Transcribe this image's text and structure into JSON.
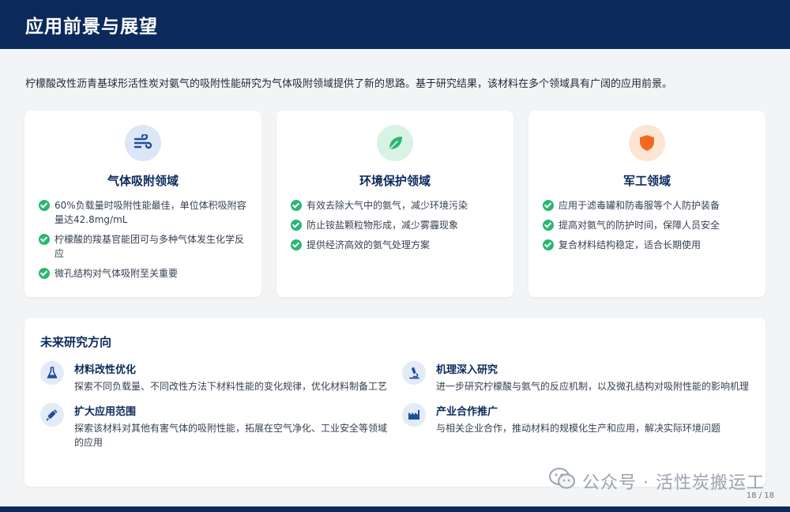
{
  "header": {
    "title": "应用前景与展望"
  },
  "intro": "柠檬酸改性沥青基球形活性炭对氨气的吸附性能研究为气体吸附领域提供了新的思路。基于研究结果，该材料在多个领域具有广阔的应用前景。",
  "cards": [
    {
      "title": "气体吸附领域",
      "icon": "wind-icon",
      "bullets": [
        "60%负载量时吸附性能最佳，单位体积吸附容量达42.8mg/mL",
        "柠檬酸的羧基官能团可与多种气体发生化学反应",
        "微孔结构对气体吸附至关重要"
      ]
    },
    {
      "title": "环境保护领域",
      "icon": "leaf-icon",
      "bullets": [
        "有效去除大气中的氨气，减少环境污染",
        "防止铵盐颗粒物形成，减少雾霾现象",
        "提供经济高效的氨气处理方案"
      ]
    },
    {
      "title": "军工领域",
      "icon": "shield-icon",
      "bullets": [
        "应用于滤毒罐和防毒服等个人防护装备",
        "提高对氨气的防护时间，保障人员安全",
        "复合材料结构稳定，适合长期使用"
      ]
    }
  ],
  "future": {
    "title": "未来研究方向",
    "items": [
      {
        "title": "材料改性优化",
        "icon": "flask-icon",
        "desc": "探索不同负载量、不同改性方法下材料性能的变化规律，优化材料制备工艺"
      },
      {
        "title": "机理深入研究",
        "icon": "microscope-icon",
        "desc": "进一步研究柠檬酸与氨气的反应机制，以及微孔结构对吸附性能的影响机理"
      },
      {
        "title": "扩大应用范围",
        "icon": "syringe-icon",
        "desc": "探索该材料对其他有害气体的吸附性能，拓展在空气净化、工业安全等领域的应用"
      },
      {
        "title": "产业合作推广",
        "icon": "factory-icon",
        "desc": "与相关企业合作，推动材料的规模化生产和应用，解决实际环境问题"
      }
    ]
  },
  "watermark": "公众号 · 活性炭搬运工",
  "page_number": "18 / 18",
  "colors": {
    "header_bg": "#0b2a5b",
    "accent_green": "#2bb673",
    "accent_orange": "#f26a21",
    "accent_blue": "#1f4e9c"
  }
}
